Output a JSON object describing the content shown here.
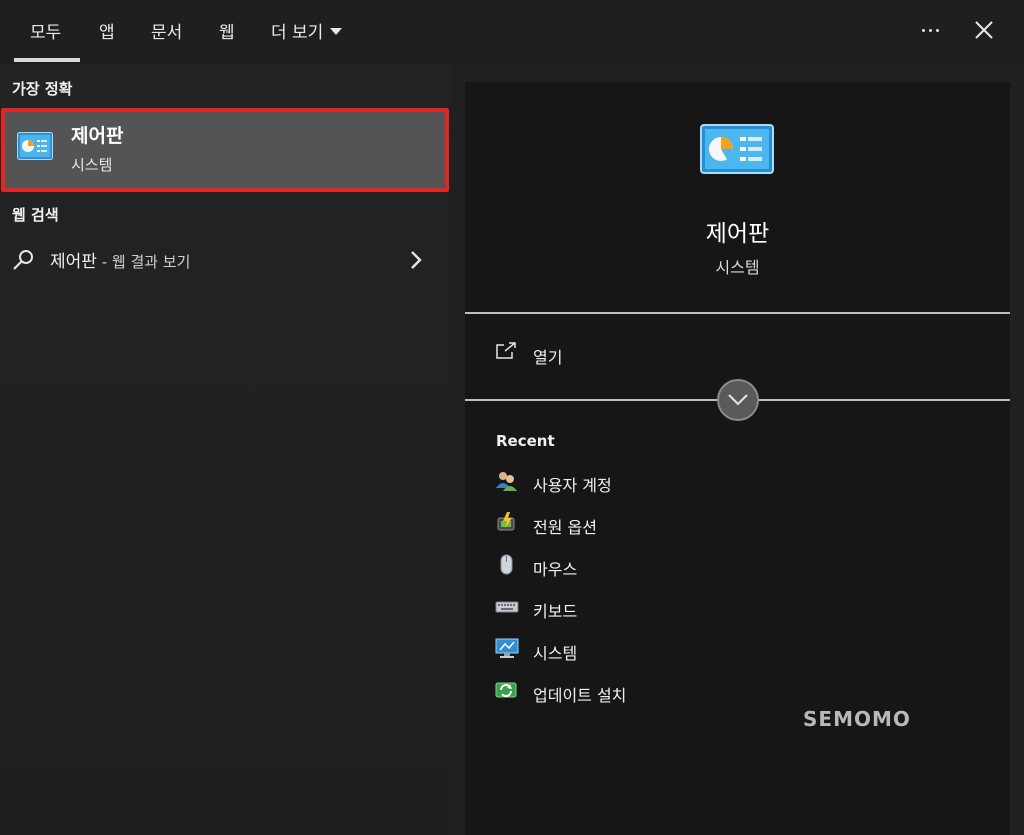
{
  "tabs": [
    {
      "label": "모두",
      "active": true
    },
    {
      "label": "앱"
    },
    {
      "label": "문서"
    },
    {
      "label": "웹"
    },
    {
      "label": "더 보기"
    }
  ],
  "left": {
    "best_match_heading": "가장 정확",
    "best_match": {
      "title": "제어판",
      "subtitle": "시스템",
      "icon": "control-panel-icon",
      "highlight_color": "#e02626"
    },
    "web_heading": "웹 검색",
    "web_result": {
      "query": "제어판",
      "suffix": " - 웹 결과 보기"
    }
  },
  "detail": {
    "title": "제어판",
    "subtitle": "시스템",
    "open_label": "열기",
    "recent_heading": "Recent",
    "recent": [
      {
        "label": "사용자 계정",
        "icon": "user-accounts-icon"
      },
      {
        "label": "전원 옵션",
        "icon": "power-options-icon"
      },
      {
        "label": "마우스",
        "icon": "mouse-icon"
      },
      {
        "label": "키보드",
        "icon": "keyboard-icon"
      },
      {
        "label": "시스템",
        "icon": "system-icon"
      },
      {
        "label": "업데이트 설치",
        "icon": "windows-update-icon"
      }
    ]
  },
  "watermark": "SEMOMO"
}
